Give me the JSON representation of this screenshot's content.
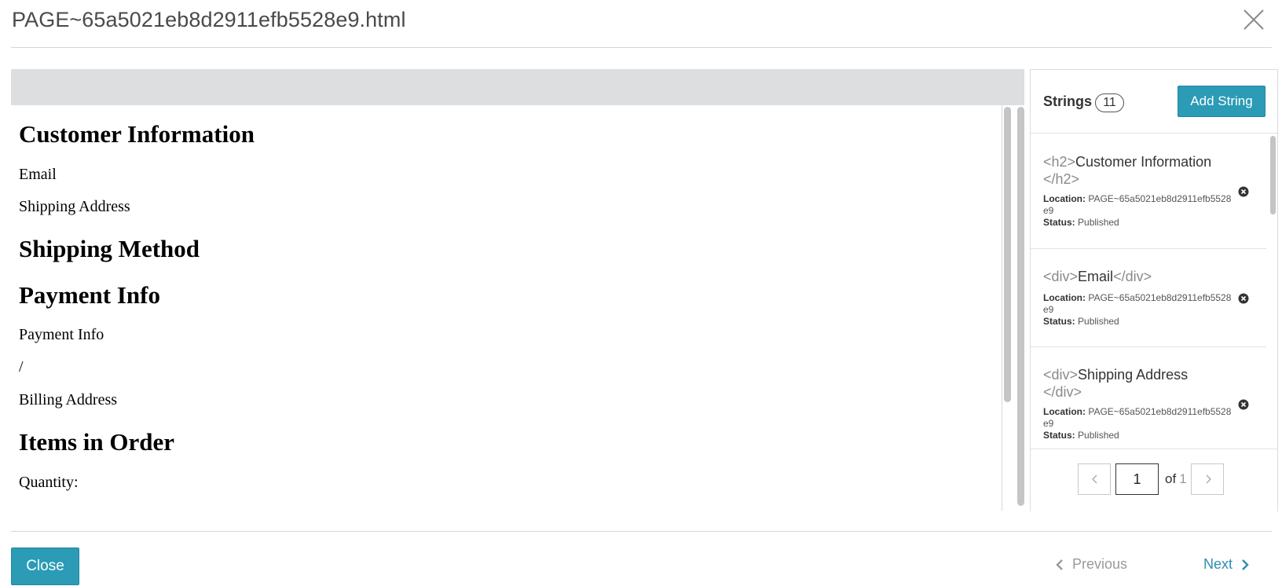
{
  "modal": {
    "title": "PAGE~65a5021eb8d2911efb5528e9.html",
    "close_label": "Close"
  },
  "preview": {
    "lines": [
      {
        "kind": "h2",
        "text": "Customer Information"
      },
      {
        "kind": "div",
        "text": "Email"
      },
      {
        "kind": "div",
        "text": "Shipping Address"
      },
      {
        "kind": "h2",
        "text": "Shipping Method"
      },
      {
        "kind": "h2",
        "text": "Payment Info"
      },
      {
        "kind": "div",
        "text": "Payment Info"
      },
      {
        "kind": "div",
        "text": "/"
      },
      {
        "kind": "div",
        "text": "Billing Address"
      },
      {
        "kind": "h2",
        "text": "Items in Order"
      },
      {
        "kind": "div",
        "text": "Quantity:"
      }
    ]
  },
  "strings": {
    "title": "Strings",
    "count": "11",
    "add_label": "Add String",
    "items": [
      {
        "open_tag": "<h2>",
        "text": "Customer Information",
        "close_tag": "</h2>",
        "location_label": "Location:",
        "location": "PAGE~65a5021eb8d2911efb5528e9",
        "status_label": "Status:",
        "status": "Published"
      },
      {
        "open_tag": "<div>",
        "text": "Email",
        "close_tag": "</div>",
        "location_label": "Location:",
        "location": "PAGE~65a5021eb8d2911efb5528e9",
        "status_label": "Status:",
        "status": "Published"
      },
      {
        "open_tag": "<div>",
        "text": "Shipping Address",
        "close_tag": "</div>",
        "location_label": "Location:",
        "location": "PAGE~65a5021eb8d2911efb5528e9",
        "status_label": "Status:",
        "status": "Published"
      }
    ],
    "pager": {
      "page": "1",
      "of_label": "of",
      "total": "1"
    }
  },
  "footer": {
    "close_label": "Close",
    "previous_label": "Previous",
    "next_label": "Next"
  },
  "colors": {
    "accent": "#2b9bb6",
    "link": "#2b8fb0",
    "topbar": "#dddee0"
  }
}
